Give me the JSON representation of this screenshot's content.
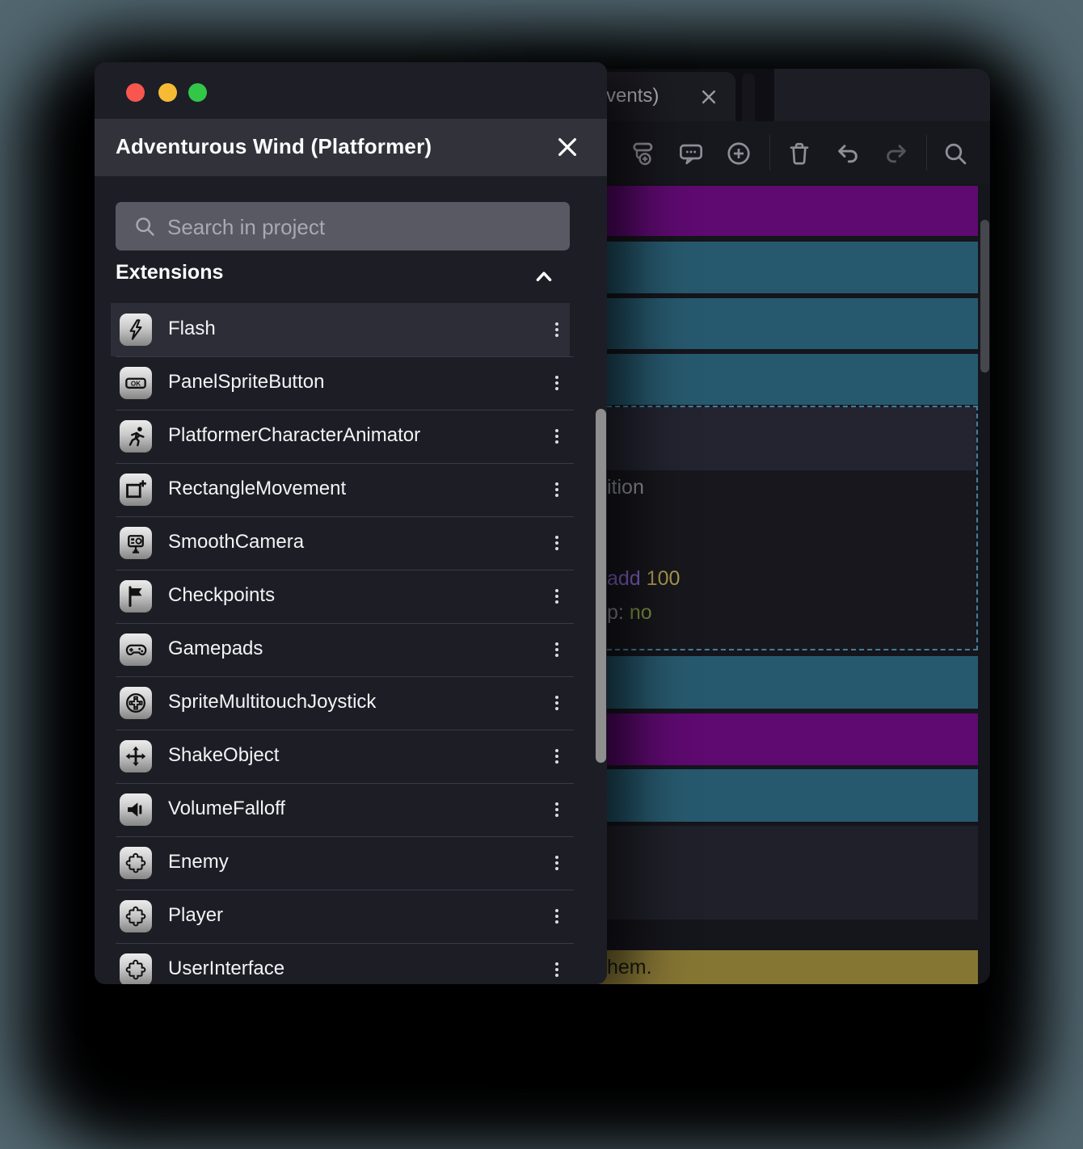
{
  "background_color": "#51666f",
  "project_manager": {
    "window_title": "Adventurous Wind (Platformer)",
    "traffic_light_colors": {
      "close": "#f8564f",
      "minimize": "#f5bb35",
      "maximize": "#33c748"
    },
    "search": {
      "placeholder": "Search in project",
      "value": ""
    },
    "section_label": "Extensions",
    "items": [
      {
        "label": "Flash",
        "icon": "flash-icon",
        "highlighted": true
      },
      {
        "label": "PanelSpriteButton",
        "icon": "ok-button-icon",
        "highlighted": false
      },
      {
        "label": "PlatformerCharacterAnimator",
        "icon": "runner-icon",
        "highlighted": false
      },
      {
        "label": "RectangleMovement",
        "icon": "rectangle-plus-icon",
        "highlighted": false
      },
      {
        "label": "SmoothCamera",
        "icon": "camera-icon",
        "highlighted": false
      },
      {
        "label": "Checkpoints",
        "icon": "flag-icon",
        "highlighted": false
      },
      {
        "label": "Gamepads",
        "icon": "gamepad-icon",
        "highlighted": false
      },
      {
        "label": "SpriteMultitouchJoystick",
        "icon": "joystick-icon",
        "highlighted": false
      },
      {
        "label": "ShakeObject",
        "icon": "move-arrows-icon",
        "highlighted": false
      },
      {
        "label": "VolumeFalloff",
        "icon": "speaker-icon",
        "highlighted": false
      },
      {
        "label": "Enemy",
        "icon": "puzzle-icon",
        "highlighted": false
      },
      {
        "label": "Player",
        "icon": "puzzle-icon",
        "highlighted": false
      },
      {
        "label": "UserInterface",
        "icon": "puzzle-icon",
        "highlighted": false
      }
    ]
  },
  "editor": {
    "tab": {
      "visible_label": "vents)"
    },
    "toolbar_icons": [
      "add-sub-event-icon",
      "add-comment-icon",
      "add-event-icon",
      "trash-icon",
      "undo-icon",
      "redo-icon",
      "search-icon"
    ],
    "topbar_icons": [
      "chevron-down-icon",
      "extensions-puzzle-icon",
      "more-options-icon"
    ],
    "selected_event": {
      "line1": "ition",
      "line2_parts": [
        {
          "text": "add",
          "color": "#8565c8"
        },
        {
          "text": "100",
          "color": "#ab9a4e"
        }
      ],
      "line3_parts": [
        {
          "text": "p:",
          "color": "#8f9097"
        },
        {
          "text": "no",
          "color": "#7d9243"
        }
      ]
    },
    "comment_visible_text": "hem.",
    "event_row_colors": {
      "condition_teal": "#27596e",
      "action_purple": "#5e0a70",
      "comment_olive": "#867634",
      "selection_border": "#41809c",
      "sub_event_dark": "#20202a"
    }
  }
}
